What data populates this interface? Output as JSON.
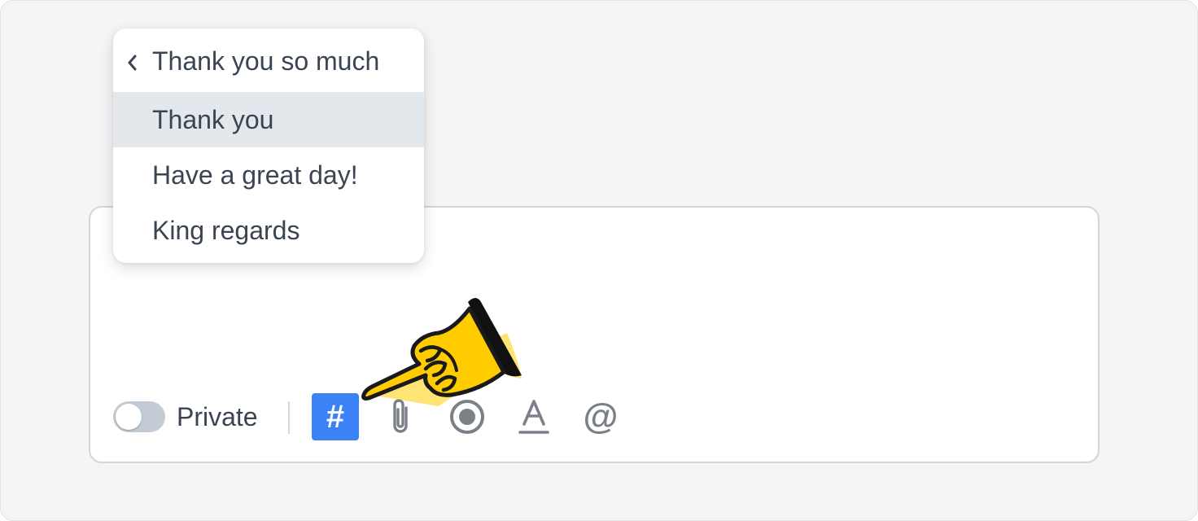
{
  "composer": {
    "private_toggle": {
      "label": "Private",
      "on": false
    },
    "tools": [
      {
        "name": "hash-tool",
        "icon": "hash-icon",
        "glyph": "#",
        "active": true
      },
      {
        "name": "attachment-tool",
        "icon": "paperclip-icon",
        "active": false
      },
      {
        "name": "record-tool",
        "icon": "record-icon",
        "active": false
      },
      {
        "name": "text-format-tool",
        "icon": "text-format-icon",
        "active": false
      },
      {
        "name": "mention-tool",
        "icon": "at-icon",
        "glyph": "@",
        "active": false
      }
    ]
  },
  "menu": {
    "header": "Thank you so much",
    "back_icon": "chevron-left-icon",
    "items": [
      {
        "label": "Thank you",
        "highlighted": true
      },
      {
        "label": "Have a great day!",
        "highlighted": false
      },
      {
        "label": "King regards",
        "highlighted": false
      }
    ]
  },
  "pointer": {
    "icon": "pointing-hand-icon"
  },
  "colors": {
    "accent": "#3b82f6",
    "text": "#3a4452",
    "icon": "#7b8088",
    "highlight": "#e2e8ec",
    "hand_fill": "#ffcc00"
  }
}
